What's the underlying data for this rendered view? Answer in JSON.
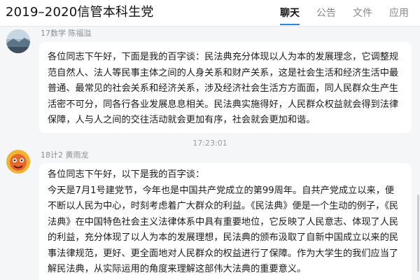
{
  "header": {
    "group_title": "2019–2020信管本科生党",
    "tabs": [
      {
        "label": "聊天",
        "active": true
      },
      {
        "label": "公告",
        "active": false
      },
      {
        "label": "文件",
        "active": false
      },
      {
        "label": "应用",
        "active": false
      }
    ]
  },
  "messages": [
    {
      "sender": "17数学 陈福溢",
      "avatar_icon": "landscape-avatar-icon",
      "text": "各位同志下午好，下面是我的百字谈：民法典充分体现以人为本的发展理念，它调整规范自然人、法人等民事主体之间的人身关系和财产关系，这是社会生活和经济生活中最普通、最常见的社会关系和经济关系，涉及经济社会生活方方面面，同人民群众生产生活密不可分，同各行各业发展息息相关。民法典实施得好，人民群众权益就会得到法律保障，人与人之间的交往活动就会更加有序，社会就会更加和谐。"
    },
    {
      "sender": "18计2 黄雨龙",
      "avatar_icon": "cartoon-face-avatar-icon",
      "text": "各位同志下午好，以下是我的百字谈：\n今天是7月1号建党节，今年也是中国共产党成立的第99周年。自共产党成立以来，便不断以人民为中心，时刻考虑着广大群众的利益。《民法典》便是一个生动的例子，《民法典》在中国特色社会主义法律体系中具有重要地位，它反映了人民意志、体现了人民的利益，充分体现了以人为本的发展理想，民法典的颁布汲取了自新中国成立以来的民事法律规范，更好、更全面地对人民群众的权益进行了保障。作为大学生的我们应当了解民法典，从实际运用的角度来理解这部伟大法典的重要意义。"
    }
  ],
  "timestamp": "17:23:01"
}
